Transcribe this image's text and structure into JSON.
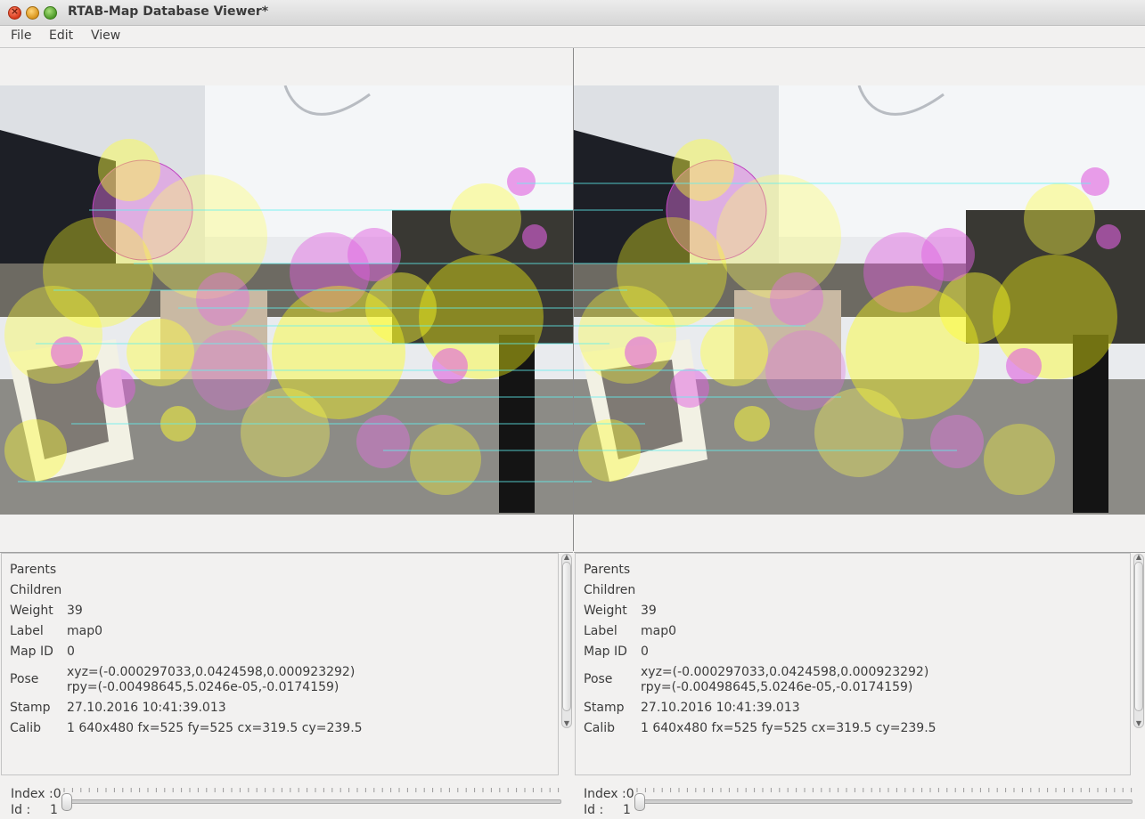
{
  "window": {
    "title": "RTAB-Map Database Viewer*"
  },
  "menu": {
    "file": "File",
    "edit": "Edit",
    "view": "View"
  },
  "colors": {
    "feature_yellow": "#ffff00",
    "feature_magenta": "#ff44ff",
    "match_line": "#5ff0f0"
  },
  "panes": [
    {
      "info": {
        "parents_key": "Parents",
        "parents_val": "",
        "children_key": "Children",
        "children_val": "",
        "weight_key": "Weight",
        "weight_val": "39",
        "label_key": "Label",
        "label_val": "map0",
        "mapid_key": "Map ID",
        "mapid_val": "0",
        "pose_key": "Pose",
        "pose_xyz": "xyz=(-0.000297033,0.0424598,0.000923292)",
        "pose_rpy": "rpy=(-0.00498645,5.0246e-05,-0.0174159)",
        "stamp_key": "Stamp",
        "stamp_val": "27.10.2016 10:41:39.013",
        "calib_key": "Calib",
        "calib_val": "1 640x480 fx=525 fy=525 cx=319.5 cy=239.5"
      },
      "slider": {
        "index_label": "Index :0",
        "id_label": "Id :",
        "id_value": "1"
      }
    },
    {
      "info": {
        "parents_key": "Parents",
        "parents_val": "",
        "children_key": "Children",
        "children_val": "",
        "weight_key": "Weight",
        "weight_val": "39",
        "label_key": "Label",
        "label_val": "map0",
        "mapid_key": "Map ID",
        "mapid_val": "0",
        "pose_key": "Pose",
        "pose_xyz": "xyz=(-0.000297033,0.0424598,0.000923292)",
        "pose_rpy": "rpy=(-0.00498645,5.0246e-05,-0.0174159)",
        "stamp_key": "Stamp",
        "stamp_val": "27.10.2016 10:41:39.013",
        "calib_key": "Calib",
        "calib_val": "1 640x480 fx=525 fy=525 cx=319.5 cy=239.5"
      },
      "slider": {
        "index_label": "Index :0",
        "id_label": "Id :",
        "id_value": "1"
      }
    }
  ]
}
